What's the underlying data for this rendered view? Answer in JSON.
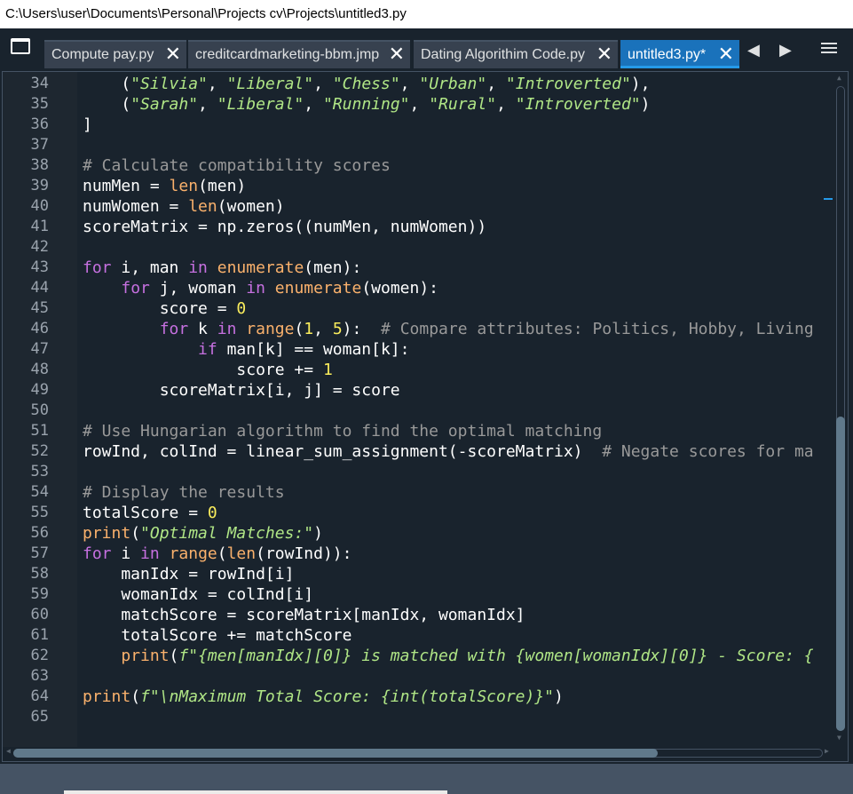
{
  "window": {
    "title": "C:\\Users\\user\\Documents\\Personal\\Projects cv\\Projects\\untitled3.py"
  },
  "tabs": [
    {
      "label": "Compute pay.py",
      "active": false
    },
    {
      "label": "creditcardmarketing-bbm.jmp",
      "active": false
    },
    {
      "label": "Dating Algorithim Code.py",
      "active": false
    },
    {
      "label": "untitled3.py*",
      "active": true
    }
  ],
  "tab_close_glyph": "✕",
  "nav": {
    "prev": "◀",
    "next": "▶"
  },
  "icons": {
    "browse": "browse-tabs-icon",
    "menu": "hamburger-menu-icon",
    "close": "close-icon"
  },
  "colors": {
    "background": "#19232d",
    "keyword": "#c670e0",
    "builtin": "#fab16c",
    "string": "#b0e686",
    "comment": "#999999",
    "number": "#faed5c",
    "active_tab": "#1a72bb"
  },
  "editor": {
    "lines": [
      {
        "n": "34",
        "t": [
          [
            "n",
            "    ("
          ],
          [
            "s",
            "\"Silvia\""
          ],
          [
            "n",
            ", "
          ],
          [
            "s",
            "\"Liberal\""
          ],
          [
            "n",
            ", "
          ],
          [
            "s",
            "\"Chess\""
          ],
          [
            "n",
            ", "
          ],
          [
            "s",
            "\"Urban\""
          ],
          [
            "n",
            ", "
          ],
          [
            "s",
            "\"Introverted\""
          ],
          [
            "n",
            "),"
          ]
        ]
      },
      {
        "n": "35",
        "t": [
          [
            "n",
            "    ("
          ],
          [
            "s",
            "\"Sarah\""
          ],
          [
            "n",
            ", "
          ],
          [
            "s",
            "\"Liberal\""
          ],
          [
            "n",
            ", "
          ],
          [
            "s",
            "\"Running\""
          ],
          [
            "n",
            ", "
          ],
          [
            "s",
            "\"Rural\""
          ],
          [
            "n",
            ", "
          ],
          [
            "s",
            "\"Introverted\""
          ],
          [
            "n",
            ")"
          ]
        ]
      },
      {
        "n": "36",
        "t": [
          [
            "n",
            "]"
          ]
        ]
      },
      {
        "n": "37",
        "t": []
      },
      {
        "n": "38",
        "t": [
          [
            "c",
            "# Calculate compatibility scores"
          ]
        ]
      },
      {
        "n": "39",
        "t": [
          [
            "n",
            "numMen = "
          ],
          [
            "b",
            "len"
          ],
          [
            "n",
            "(men)"
          ]
        ]
      },
      {
        "n": "40",
        "t": [
          [
            "n",
            "numWomen = "
          ],
          [
            "b",
            "len"
          ],
          [
            "n",
            "(women)"
          ]
        ]
      },
      {
        "n": "41",
        "t": [
          [
            "n",
            "scoreMatrix = np.zeros((numMen, numWomen))"
          ]
        ]
      },
      {
        "n": "42",
        "t": []
      },
      {
        "n": "43",
        "t": [
          [
            "k",
            "for"
          ],
          [
            "n",
            " i, man "
          ],
          [
            "k",
            "in"
          ],
          [
            "n",
            " "
          ],
          [
            "b",
            "enumerate"
          ],
          [
            "n",
            "(men):"
          ]
        ]
      },
      {
        "n": "44",
        "t": [
          [
            "n",
            "    "
          ],
          [
            "k",
            "for"
          ],
          [
            "n",
            " j, woman "
          ],
          [
            "k",
            "in"
          ],
          [
            "n",
            " "
          ],
          [
            "b",
            "enumerate"
          ],
          [
            "n",
            "(women):"
          ]
        ]
      },
      {
        "n": "45",
        "t": [
          [
            "n",
            "        score = "
          ],
          [
            "num",
            "0"
          ]
        ]
      },
      {
        "n": "46",
        "t": [
          [
            "n",
            "        "
          ],
          [
            "k",
            "for"
          ],
          [
            "n",
            " k "
          ],
          [
            "k",
            "in"
          ],
          [
            "n",
            " "
          ],
          [
            "b",
            "range"
          ],
          [
            "n",
            "("
          ],
          [
            "num",
            "1"
          ],
          [
            "n",
            ", "
          ],
          [
            "num",
            "5"
          ],
          [
            "n",
            "):  "
          ],
          [
            "c",
            "# Compare attributes: Politics, Hobby, Living"
          ]
        ]
      },
      {
        "n": "47",
        "t": [
          [
            "n",
            "            "
          ],
          [
            "k",
            "if"
          ],
          [
            "n",
            " man[k] == woman[k]:"
          ]
        ]
      },
      {
        "n": "48",
        "t": [
          [
            "n",
            "                score += "
          ],
          [
            "num",
            "1"
          ]
        ]
      },
      {
        "n": "49",
        "t": [
          [
            "n",
            "        scoreMatrix[i, j] = score"
          ]
        ]
      },
      {
        "n": "50",
        "t": []
      },
      {
        "n": "51",
        "t": [
          [
            "c",
            "# Use Hungarian algorithm to find the optimal matching"
          ]
        ]
      },
      {
        "n": "52",
        "t": [
          [
            "n",
            "rowInd, colInd = linear_sum_assignment(-scoreMatrix)  "
          ],
          [
            "c",
            "# Negate scores for ma"
          ]
        ]
      },
      {
        "n": "53",
        "t": []
      },
      {
        "n": "54",
        "t": [
          [
            "c",
            "# Display the results"
          ]
        ]
      },
      {
        "n": "55",
        "t": [
          [
            "n",
            "totalScore = "
          ],
          [
            "num",
            "0"
          ]
        ]
      },
      {
        "n": "56",
        "t": [
          [
            "b",
            "print"
          ],
          [
            "n",
            "("
          ],
          [
            "s",
            "\"Optimal Matches:\""
          ],
          [
            "n",
            ")"
          ]
        ]
      },
      {
        "n": "57",
        "t": [
          [
            "k",
            "for"
          ],
          [
            "n",
            " i "
          ],
          [
            "k",
            "in"
          ],
          [
            "n",
            " "
          ],
          [
            "b",
            "range"
          ],
          [
            "n",
            "("
          ],
          [
            "b",
            "len"
          ],
          [
            "n",
            "(rowInd)):"
          ]
        ]
      },
      {
        "n": "58",
        "t": [
          [
            "n",
            "    manIdx = rowInd[i]"
          ]
        ]
      },
      {
        "n": "59",
        "t": [
          [
            "n",
            "    womanIdx = colInd[i]"
          ]
        ]
      },
      {
        "n": "60",
        "t": [
          [
            "n",
            "    matchScore = scoreMatrix[manIdx, womanIdx]"
          ]
        ]
      },
      {
        "n": "61",
        "t": [
          [
            "n",
            "    totalScore += matchScore"
          ]
        ]
      },
      {
        "n": "62",
        "t": [
          [
            "n",
            "    "
          ],
          [
            "b",
            "print"
          ],
          [
            "n",
            "("
          ],
          [
            "s",
            "f\"{men[manIdx][0]} is matched with {women[womanIdx][0]} - Score: {"
          ]
        ]
      },
      {
        "n": "63",
        "t": []
      },
      {
        "n": "64",
        "t": [
          [
            "b",
            "print"
          ],
          [
            "n",
            "("
          ],
          [
            "s",
            "f\"\\nMaximum Total Score: {int(totalScore)}\""
          ],
          [
            "n",
            ")"
          ]
        ]
      },
      {
        "n": "65",
        "t": []
      }
    ]
  }
}
